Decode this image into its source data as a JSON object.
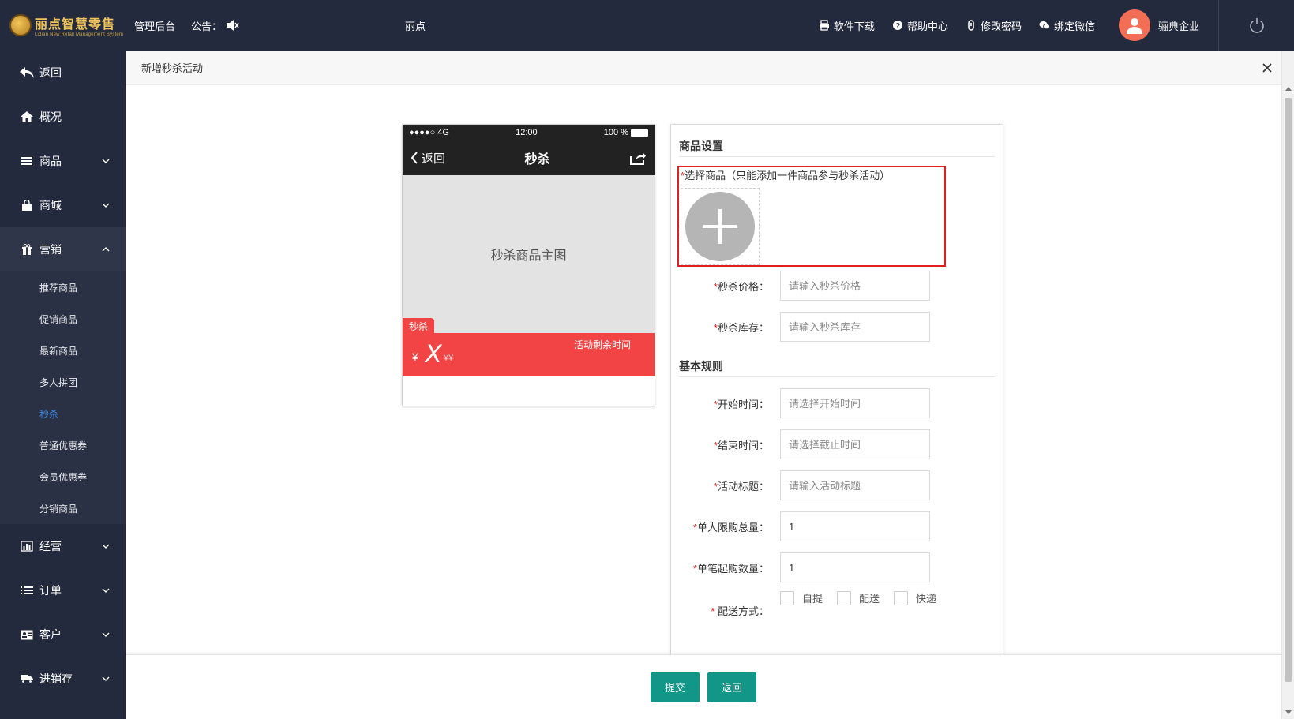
{
  "header": {
    "logo_cn": "丽点智慧零售",
    "logo_en": "Lidian New Retail Management System",
    "admin_title": "管理后台",
    "notice_label": "公告：",
    "notice_text": "丽点",
    "links": [
      {
        "label": "软件下载",
        "icon": "printer-icon"
      },
      {
        "label": "帮助中心",
        "icon": "help-icon"
      },
      {
        "label": "修改密码",
        "icon": "key-icon"
      },
      {
        "label": "绑定微信",
        "icon": "wechat-icon"
      }
    ],
    "company": "骊典企业"
  },
  "sidebar": {
    "items": [
      {
        "label": "返回",
        "icon": "back-arrow-icon"
      },
      {
        "label": "概况",
        "icon": "home-icon"
      },
      {
        "label": "商品",
        "icon": "list-icon"
      },
      {
        "label": "商城",
        "icon": "bag-icon"
      },
      {
        "label": "营销",
        "icon": "gift-icon"
      },
      {
        "label": "经营",
        "icon": "bar-chart-icon"
      },
      {
        "label": "订单",
        "icon": "list-icon"
      },
      {
        "label": "客户",
        "icon": "id-card-icon"
      },
      {
        "label": "进销存",
        "icon": "truck-icon"
      }
    ],
    "marketing_sub": [
      {
        "label": "推荐商品"
      },
      {
        "label": "促销商品"
      },
      {
        "label": "最新商品"
      },
      {
        "label": "多人拼团"
      },
      {
        "label": "秒杀",
        "active": true
      },
      {
        "label": "普通优惠券"
      },
      {
        "label": "会员优惠券"
      },
      {
        "label": "分销商品"
      }
    ]
  },
  "modal": {
    "title": "新增秒杀活动"
  },
  "phone": {
    "carrier": "●●●●○ 4G",
    "time": "12:00",
    "battery": "100 %",
    "back": "返回",
    "title": "秒杀",
    "main_image_text": "秒杀商品主图",
    "badge": "秒杀",
    "yen": "¥",
    "price": "X",
    "orig_price": "¥¥",
    "remain_label": "活动剩余时间"
  },
  "form": {
    "section_goods": "商品设置",
    "select_goods_req": "*",
    "select_goods_label": "选择商品（只能添加一件商品参与秒杀活动）",
    "price_label": "秒杀价格：",
    "price_placeholder": "请输入秒杀价格",
    "stock_label": "秒杀库存：",
    "stock_placeholder": "请输入秒杀库存",
    "section_rules": "基本规则",
    "start_label": "开始时间：",
    "start_placeholder": "请选择开始时间",
    "end_label": "结束时间：",
    "end_placeholder": "请选择截止时间",
    "title_label": "活动标题：",
    "title_placeholder": "请输入活动标题",
    "limit_label": "单人限购总量：",
    "limit_value": "1",
    "min_label": "单笔起购数量：",
    "min_value": "1",
    "delivery_label": "配送方式：",
    "delivery_options": [
      "自提",
      "配送",
      "快递"
    ]
  },
  "footer": {
    "submit": "提交",
    "back": "返回"
  },
  "colors": {
    "header_bg": "#232a3d",
    "accent_teal": "#119688",
    "price_red": "#f24444",
    "active_blue": "#3d8ce6",
    "highlight_red": "#e02020"
  }
}
